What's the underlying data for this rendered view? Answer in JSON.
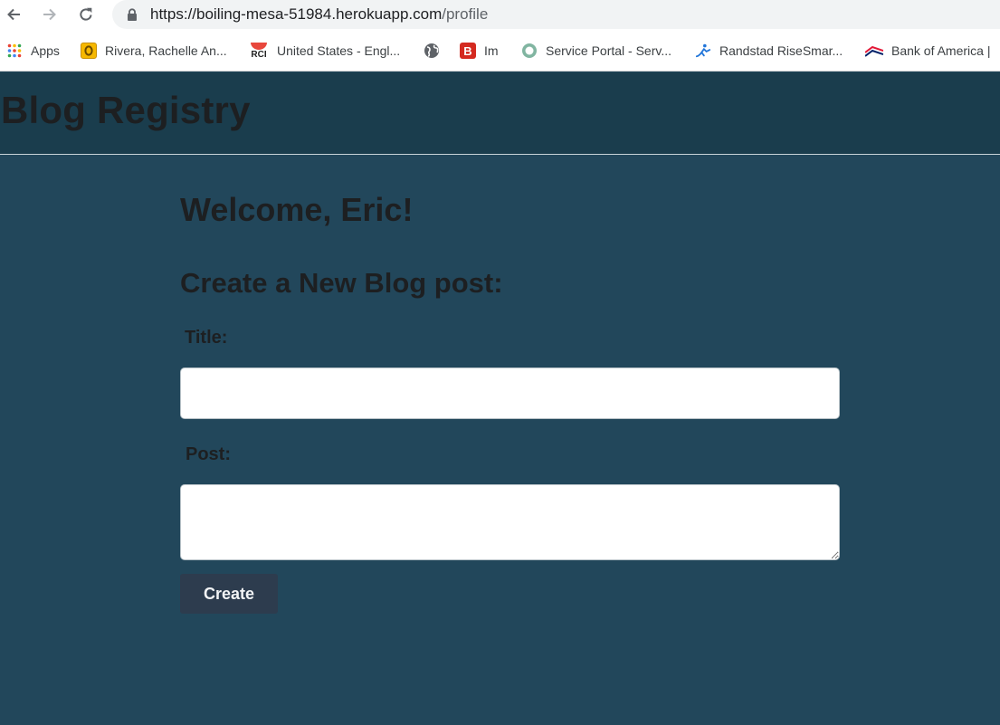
{
  "browser": {
    "url_host": "https://boiling-mesa-51984.herokuapp.com",
    "url_path": "/profile",
    "bookmarks": [
      {
        "label": "Apps",
        "icon": "apps-grid-icon"
      },
      {
        "label": "Rivera, Rachelle An...",
        "icon": "outlook-icon"
      },
      {
        "label": "United States - Engl...",
        "icon": "rci-icon",
        "icon_text": "RCI"
      },
      {
        "label": "",
        "icon": "globe-icon"
      },
      {
        "label": "Im",
        "icon": "b-icon",
        "icon_text": "B"
      },
      {
        "label": "Service Portal - Serv...",
        "icon": "service-portal-icon"
      },
      {
        "label": "Randstad RiseSmar...",
        "icon": "randstad-icon"
      },
      {
        "label": "Bank of America |",
        "icon": "bank-of-america-icon"
      }
    ]
  },
  "site": {
    "brand": "Blog Registry"
  },
  "profile": {
    "welcome": "Welcome, Eric!",
    "form_heading": "Create a New Blog post:",
    "title_label": "Title:",
    "title_value": "",
    "post_label": "Post:",
    "post_value": "",
    "create_label": "Create"
  },
  "colors": {
    "page_background": "#22475b",
    "header_background": "#1a3d4d",
    "button_background": "#2d3c4e",
    "heading_text": "#1d1f21"
  }
}
